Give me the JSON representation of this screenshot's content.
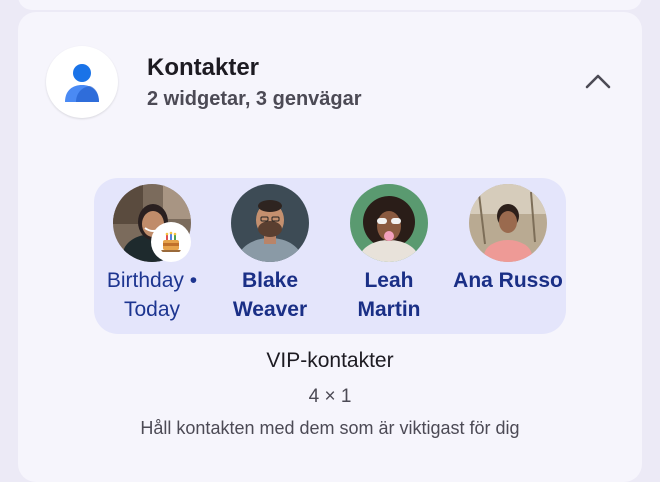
{
  "app": {
    "title": "Kontakter",
    "subtitle": "2 widgetar, 3 genvägar",
    "icon": "person-icon",
    "collapse_icon": "chevron-up-icon"
  },
  "widget": {
    "contacts": [
      {
        "name": "Birthday • Today",
        "avatar_icon": "avatar-photo",
        "badge_icon": "birthday-cake-icon"
      },
      {
        "name": "Blake\nWeaver",
        "avatar_icon": "avatar-photo"
      },
      {
        "name": "Leah\nMartin",
        "avatar_icon": "avatar-photo"
      },
      {
        "name": "Ana Russo",
        "avatar_icon": "avatar-photo"
      }
    ],
    "name": "VIP-kontakter",
    "size": "4 × 1",
    "description": "Håll kontakten med dem som är viktigast för dig"
  },
  "colors": {
    "background": "#eceaf6",
    "card": "#f6f5fc",
    "panel": "#e4e5fb",
    "contact_text": "#1a2f86",
    "icon_blue": "#1a73e8"
  }
}
